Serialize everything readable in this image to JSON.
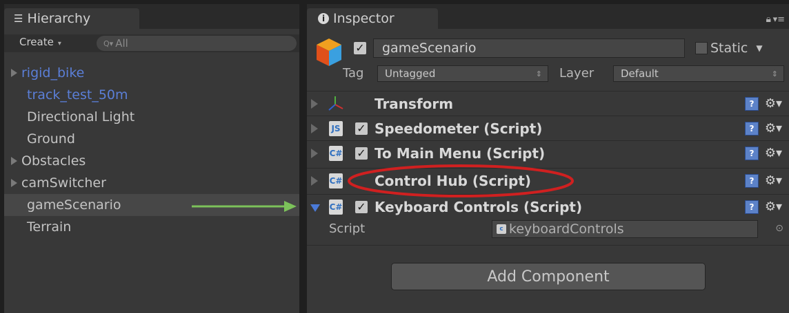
{
  "hierarchy": {
    "tab_label": "Hierarchy",
    "tab_icon": "list-icon",
    "create_label": "Create",
    "search_placeholder": "All",
    "items": [
      {
        "label": "rigid_bike",
        "expandable": true,
        "prefab": true
      },
      {
        "label": "track_test_50m",
        "expandable": false,
        "prefab": true
      },
      {
        "label": "Directional Light",
        "expandable": false,
        "prefab": false
      },
      {
        "label": "Ground",
        "expandable": false,
        "prefab": false
      },
      {
        "label": "Obstacles",
        "expandable": true,
        "prefab": false
      },
      {
        "label": "camSwitcher",
        "expandable": true,
        "prefab": false
      },
      {
        "label": "gameScenario",
        "expandable": false,
        "prefab": false,
        "selected": true
      },
      {
        "label": "Terrain",
        "expandable": false,
        "prefab": false
      }
    ]
  },
  "inspector": {
    "tab_label": "Inspector",
    "tab_icon": "info-icon",
    "object_name": "gameScenario",
    "active": true,
    "static_label": "Static",
    "tag_label": "Tag",
    "tag_value": "Untagged",
    "layer_label": "Layer",
    "layer_value": "Default",
    "components": [
      {
        "title": "Transform",
        "icon": "transform-icon",
        "has_checkbox": false,
        "expanded": false
      },
      {
        "title": "Speedometer (Script)",
        "icon": "js-script-icon",
        "icon_text": "JS",
        "has_checkbox": true,
        "expanded": false
      },
      {
        "title": "To Main Menu (Script)",
        "icon": "csharp-script-icon",
        "icon_text": "C#",
        "has_checkbox": true,
        "expanded": false
      },
      {
        "title": "Control Hub (Script)",
        "icon": "csharp-script-icon",
        "icon_text": "C#",
        "has_checkbox": false,
        "expanded": false
      },
      {
        "title": "Keyboard Controls (Script)",
        "icon": "csharp-script-icon",
        "icon_text": "C#",
        "has_checkbox": true,
        "expanded": true
      }
    ],
    "script_label": "Script",
    "script_value": "keyboardControls",
    "add_component_label": "Add Component"
  },
  "colors": {
    "panel": "#383838",
    "prefab_blue": "#5b7fd8",
    "annotation_red": "#d02020",
    "annotation_green": "#7cc25a"
  }
}
